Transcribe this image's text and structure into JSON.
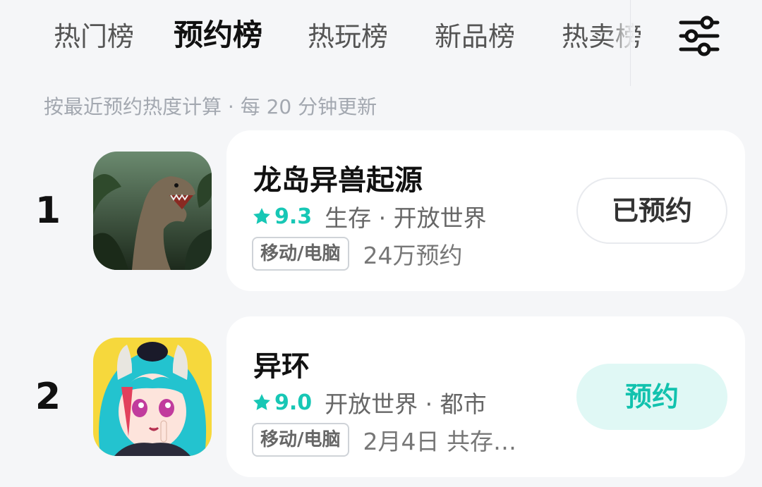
{
  "tabs": [
    {
      "label": "热门榜",
      "active": false
    },
    {
      "label": "预约榜",
      "active": true
    },
    {
      "label": "热玩榜",
      "active": false
    },
    {
      "label": "新品榜",
      "active": false
    },
    {
      "label": "热卖榜",
      "active": false
    }
  ],
  "filter_icon": "sliders-icon",
  "subtitle": "按最近预约热度计算 · 每 20 分钟更新",
  "accent_color": "#19d3c0",
  "games": [
    {
      "rank": "1",
      "name": "龙岛异兽起源",
      "score": "9.3",
      "genre": "生存 · 开放世界",
      "platform": "移动/电脑",
      "extra": "24万预约",
      "button": "已预约",
      "reserved": true
    },
    {
      "rank": "2",
      "name": "异环",
      "score": "9.0",
      "genre": "开放世界 · 都市",
      "platform": "移动/电脑",
      "extra": "2月4日 共存…",
      "button": "预约",
      "reserved": false
    }
  ]
}
